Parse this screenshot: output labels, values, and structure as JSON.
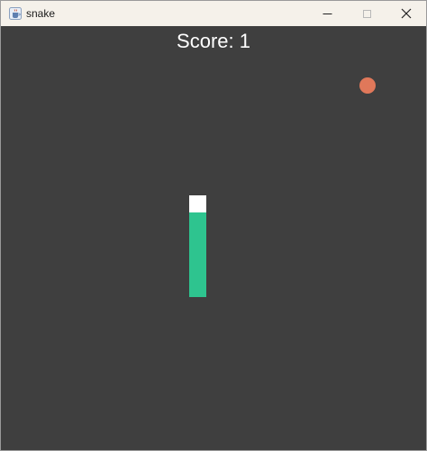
{
  "window": {
    "title": "snake",
    "icon": "java-cup-icon"
  },
  "controls": {
    "minimize": "minimize-icon",
    "maximize": "maximize-icon",
    "close": "close-icon"
  },
  "game": {
    "score_text": "Score: 1",
    "score": 1,
    "colors": {
      "background": "#3f3f3f",
      "snake_head": "#ffffff",
      "snake_body": "#2ec48f",
      "food": "#e0785a",
      "text": "#ffffff"
    }
  }
}
